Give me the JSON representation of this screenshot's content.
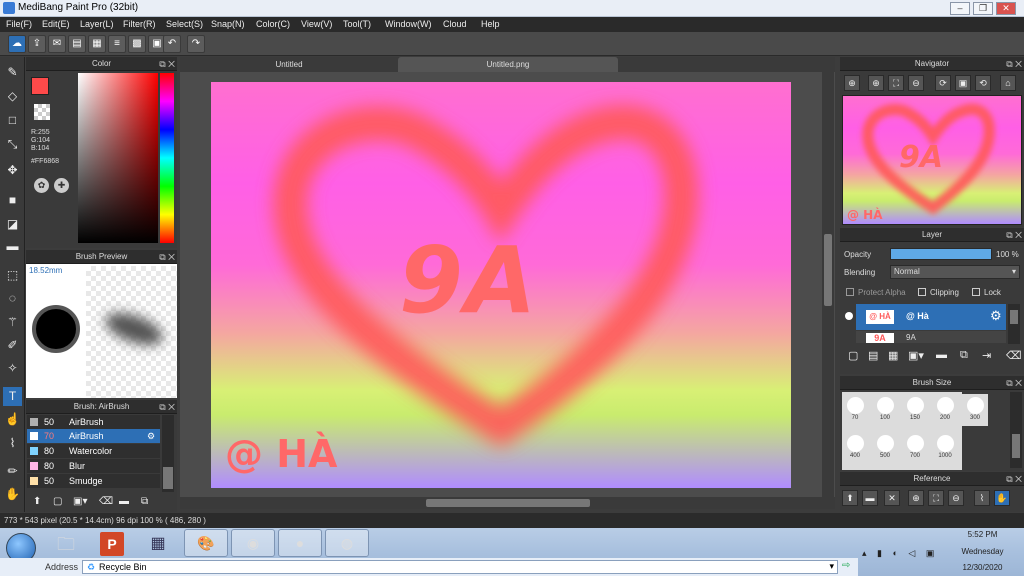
{
  "window": {
    "title": "MediBang Paint Pro (32bit)"
  },
  "menu": [
    "File(F)",
    "Edit(E)",
    "Layer(L)",
    "Filter(R)",
    "Select(S)",
    "Snap(N)",
    "Color(C)",
    "View(V)",
    "Tool(T)",
    "Window(W)",
    "Cloud",
    "Help"
  ],
  "panels": {
    "color": {
      "title": "Color",
      "r": "R:255",
      "g": "G:104",
      "b": "B:104",
      "hex": "#FF6868"
    },
    "brush_preview": {
      "title": "Brush Preview",
      "size": "18.52mm"
    },
    "brush": {
      "title": "Brush: AirBrush",
      "items": [
        {
          "size": "50",
          "name": "AirBrush",
          "swatch": "#b0b0b0"
        },
        {
          "size": "70",
          "name": "AirBrush",
          "swatch": "#ffffff"
        },
        {
          "size": "80",
          "name": "Watercolor",
          "swatch": "#7fd3ff"
        },
        {
          "size": "80",
          "name": "Blur",
          "swatch": "#ffb6e6"
        },
        {
          "size": "50",
          "name": "Smudge",
          "swatch": "#ffe0a8"
        }
      ]
    },
    "navigator": {
      "title": "Navigator"
    },
    "layer": {
      "title": "Layer",
      "opacity_label": "Opacity",
      "opacity_value": "100 %",
      "blending_label": "Blending",
      "blending_value": "Normal",
      "protect_alpha": "Protect Alpha",
      "clipping": "Clipping",
      "lock": "Lock",
      "layers": [
        {
          "name": "@ Hà"
        },
        {
          "name": "9A"
        }
      ]
    },
    "brush_size": {
      "title": "Brush Size",
      "sizes": [
        "70",
        "100",
        "150",
        "200",
        "300",
        "400",
        "500",
        "700",
        "1000"
      ]
    },
    "reference": {
      "title": "Reference"
    }
  },
  "tabs": [
    "Untitled",
    "Untitled.png"
  ],
  "canvas": {
    "text_main": "9A",
    "text_sign": "@ HÀ",
    "nav_main": "9A",
    "nav_sign": "@ HÀ"
  },
  "status": "773 * 543 pixel  (20.5 * 14.4cm)  96 dpi  100 %  ( 486, 280 )",
  "taskbar": {
    "time": "5:52 PM",
    "day": "Wednesday",
    "date": "12/30/2020",
    "address_label": "Address",
    "address_value": "Recycle Bin"
  },
  "colors": {
    "accent": "#2d6fb5",
    "primary": "#ff4a4a",
    "heart": "#ff5a5a"
  }
}
